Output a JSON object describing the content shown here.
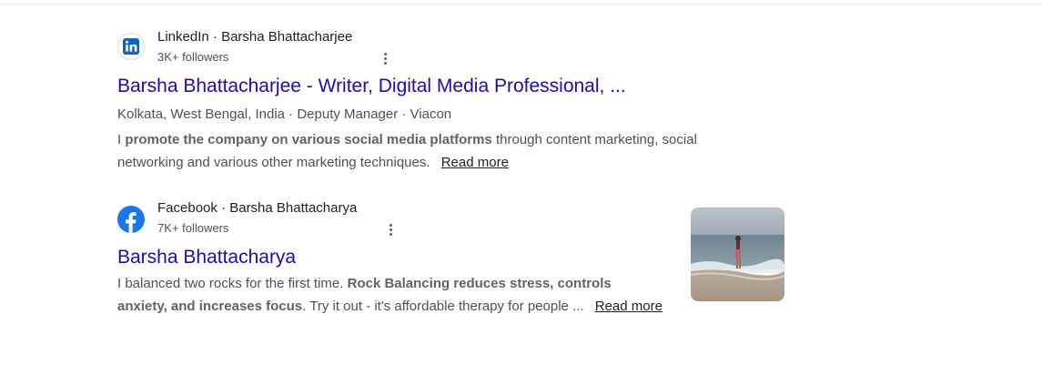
{
  "results": [
    {
      "favicon": "linkedin-icon",
      "site": "LinkedIn",
      "separator": " · ",
      "author": "Barsha Bhattacharjee",
      "followers": "3K+ followers",
      "title": "Barsha Bhattacharjee - Writer, Digital Media Professional, ...",
      "meta": "Kolkata, West Bengal, India · Deputy Manager · Viacon",
      "snippet_parts": {
        "p1": "I ",
        "b1": "promote the company on various social media platforms",
        "p2": " through content marketing, social networking and various other marketing techniques. "
      },
      "read_more": "Read more"
    },
    {
      "favicon": "facebook-icon",
      "site": "Facebook",
      "separator": " · ",
      "author": "Barsha Bhattacharya",
      "followers": "7K+ followers",
      "title": "Barsha Bhattacharya",
      "snippet_parts": {
        "p1": "I balanced two rocks for the first time. ",
        "b1": "Rock Balancing reduces stress, controls anxiety, and increases focus",
        "p2": ". Try it out - it's affordable therapy for people ... "
      },
      "read_more": "Read more",
      "thumbnail": "beach-photo-thumbnail"
    }
  ],
  "colors": {
    "link": "#1a0dab",
    "text": "#4d5156",
    "linkedin": "#0a66c2",
    "facebook": "#1877f2"
  }
}
